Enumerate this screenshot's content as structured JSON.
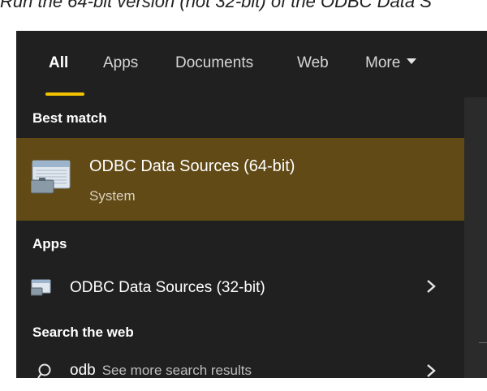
{
  "caption": "Run the 64-bit version (not 32-bit) of the ODBC Data S",
  "tabs": [
    {
      "label": "All",
      "active": true
    },
    {
      "label": "Apps"
    },
    {
      "label": "Documents"
    },
    {
      "label": "Web"
    },
    {
      "label": "More"
    }
  ],
  "sections": {
    "best_match": "Best match",
    "apps": "Apps",
    "search_web": "Search the web"
  },
  "best_match_item": {
    "title": "ODBC Data Sources (64-bit)",
    "subtitle": "System",
    "icon": "odbc-app-icon"
  },
  "apps_items": [
    {
      "title": "ODBC Data Sources (32-bit)",
      "icon": "odbc-app-icon",
      "arrow": "chevron-right-icon"
    }
  ],
  "web_search": {
    "query": "odb",
    "more_text": "See more search results",
    "icon": "search-icon"
  },
  "colors": {
    "panel_bg": "#202020",
    "highlight_bg": "#614a16",
    "accent": "#f2c200"
  }
}
